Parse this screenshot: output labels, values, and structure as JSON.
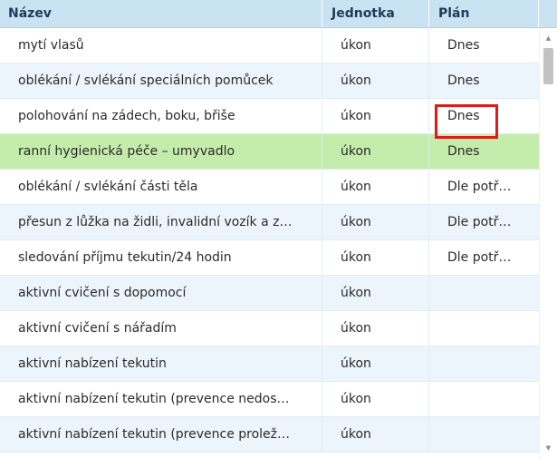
{
  "columns": {
    "name": "Název",
    "unit": "Jednotka",
    "plan": "Plán"
  },
  "rows": [
    {
      "name": "mytí vlasů",
      "unit": "úkon",
      "plan": "Dnes"
    },
    {
      "name": "oblékání / svlékání speciálních pomůcek",
      "unit": "úkon",
      "plan": "Dnes"
    },
    {
      "name": "polohování na zádech, boku, břiše",
      "unit": "úkon",
      "plan": "Dnes"
    },
    {
      "name": "ranní hygienická péče – umyvadlo",
      "unit": "úkon",
      "plan": "Dnes"
    },
    {
      "name": "oblékání / svlékání části těla",
      "unit": "úkon",
      "plan": "Dle potř…"
    },
    {
      "name": "přesun z lůžka na židli, invalidní vozík a z…",
      "unit": "úkon",
      "plan": "Dle potř…"
    },
    {
      "name": "sledování příjmu tekutin/24 hodin",
      "unit": "úkon",
      "plan": "Dle potř…"
    },
    {
      "name": "aktivní cvičení s dopomocí",
      "unit": "úkon",
      "plan": ""
    },
    {
      "name": "aktivní cvičení s nářadím",
      "unit": "úkon",
      "plan": ""
    },
    {
      "name": "aktivní nabízení tekutin",
      "unit": "úkon",
      "plan": ""
    },
    {
      "name": "aktivní nabízení tekutin (prevence nedos…",
      "unit": "úkon",
      "plan": ""
    },
    {
      "name": "aktivní nabízení tekutin (prevence prolež…",
      "unit": "úkon",
      "plan": ""
    }
  ],
  "selected_row_index": 3,
  "colors": {
    "header_bg": "#c9e3f3",
    "alt_row_bg": "#ecf5fb",
    "selected_row_bg": "#c4ecab",
    "highlight_border": "#e01a1a"
  },
  "scrollbar": {
    "up_icon": "arrow-up-icon",
    "down_icon": "arrow-down-icon"
  }
}
